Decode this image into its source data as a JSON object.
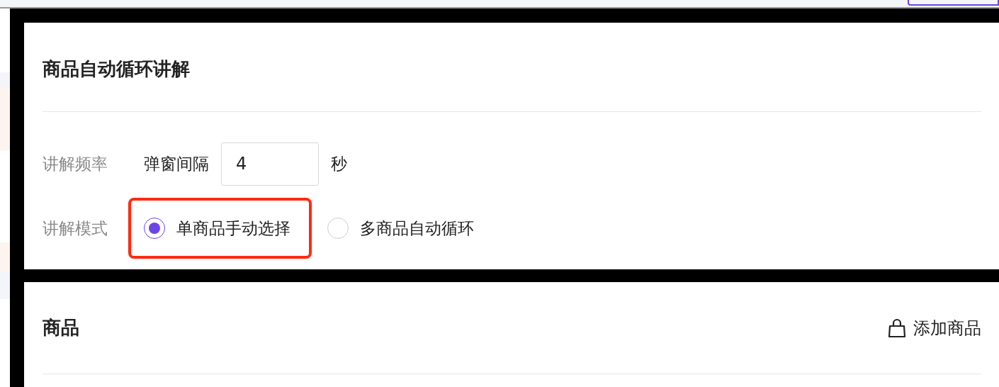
{
  "explain_card": {
    "title": "商品自动循环讲解",
    "frequency": {
      "label": "讲解频率",
      "prefix": "弹窗间隔",
      "value": "4",
      "unit": "秒"
    },
    "mode": {
      "label": "讲解模式",
      "options": [
        {
          "label": "单商品手动选择",
          "selected": true,
          "highlighted": true
        },
        {
          "label": "多商品自动循环",
          "selected": false,
          "highlighted": false
        }
      ]
    }
  },
  "products_card": {
    "title": "商品",
    "add_button": "添加商品"
  }
}
